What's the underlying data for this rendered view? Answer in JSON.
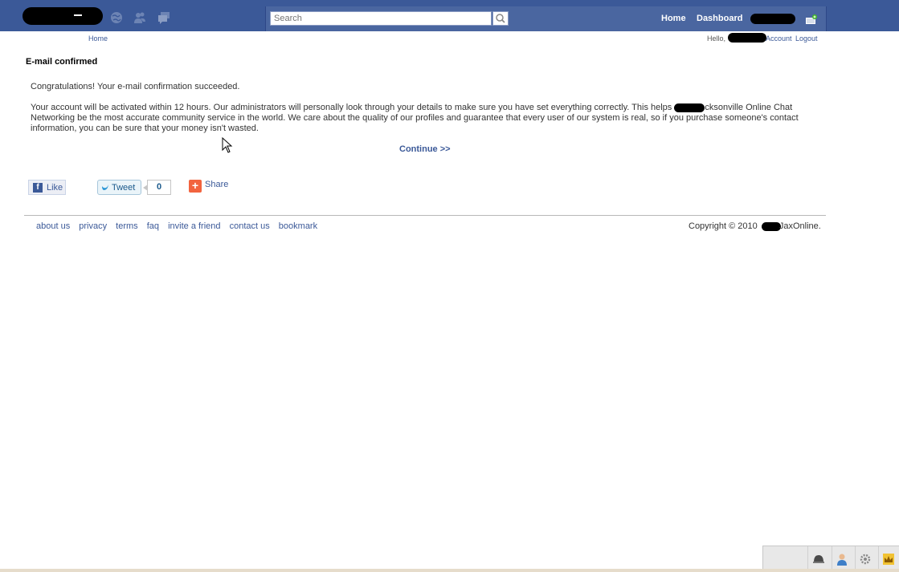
{
  "header": {
    "search_placeholder": "Search",
    "nav": {
      "home": "Home",
      "dashboard": "Dashboard"
    }
  },
  "subnav": {
    "home": "Home",
    "hello": "Hello,",
    "account": "Account",
    "logout": "Logout"
  },
  "main": {
    "title": "E-mail confirmed",
    "congrats": "Congratulations! Your e-mail confirmation succeeded.",
    "body_part1": "Your account will be activated within 12 hours. Our administrators will personally look through your details to make sure you have set everything correctly. This helps ",
    "body_part2": "cksonville Online Chat Networking be the most accurate community service in the world. We care about the quality of our profiles and guarantee that every user of our system is real, so if you purchase someone's contact information, you can be sure that your money isn't wasted.",
    "continue": "Continue >>"
  },
  "social": {
    "like": "Like",
    "tweet": "Tweet",
    "tweet_count": "0",
    "share": "Share"
  },
  "footer": {
    "links": [
      "about us",
      "privacy",
      "terms",
      "faq",
      "invite a friend",
      "contact us",
      "bookmark"
    ],
    "copyright_prefix": "Copyright © 2010 ",
    "copyright_suffix": "JaxOnline."
  },
  "colors": {
    "header_bg": "#3b5998",
    "link": "#3b5998"
  },
  "icons": {
    "header": [
      "globe-icon",
      "friends-icon",
      "messages-icon",
      "search-icon",
      "friend-request-icon"
    ],
    "taskbar": [
      "helmet-icon",
      "user-icon",
      "gear-icon",
      "crown-icon"
    ]
  }
}
